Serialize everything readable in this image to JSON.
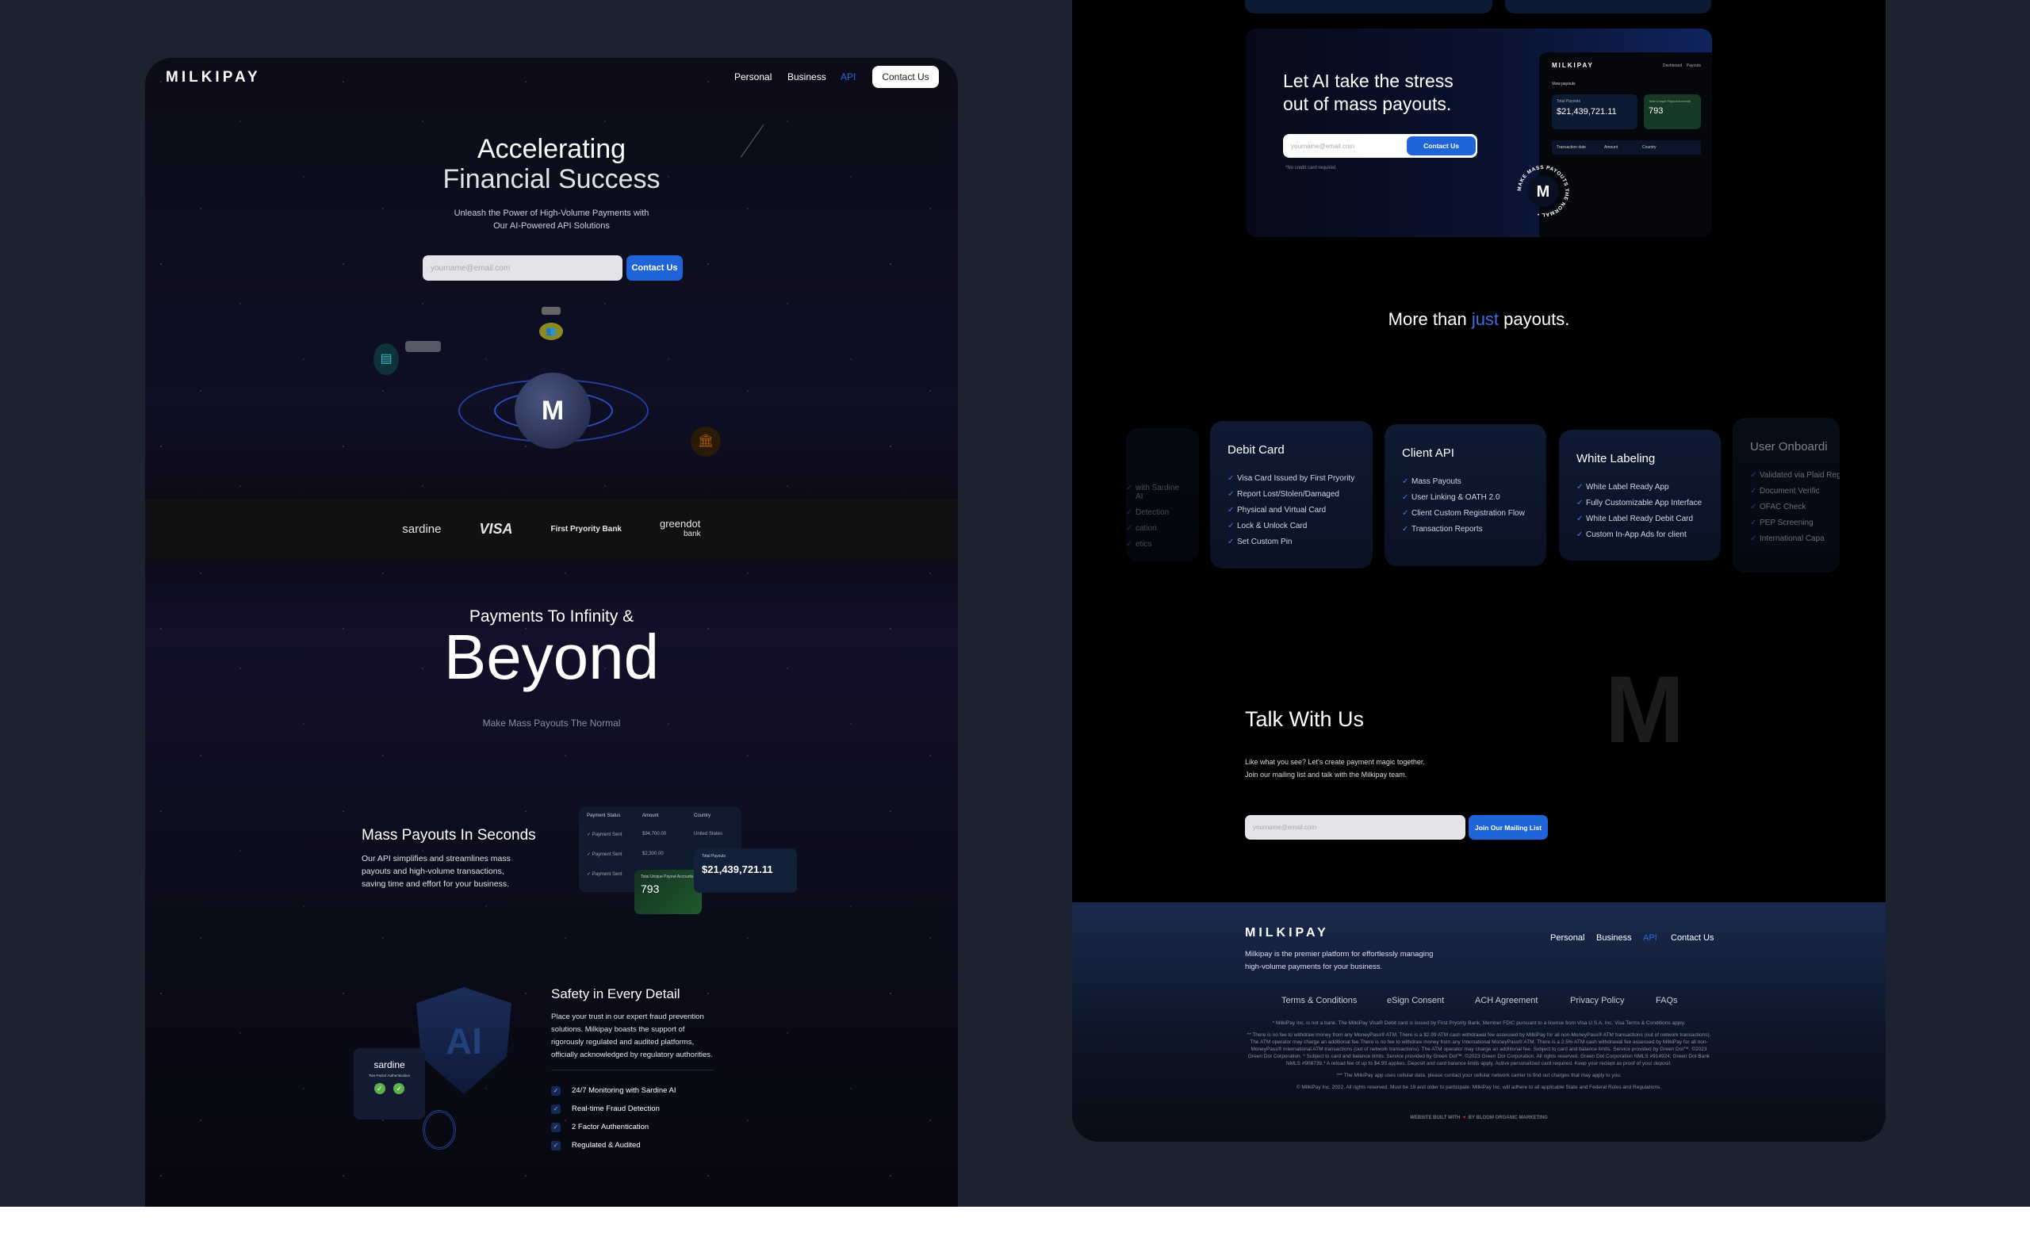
{
  "left": {
    "nav": {
      "logo": "MILKIPAY",
      "items": [
        "Personal",
        "Business",
        "API"
      ],
      "contact": "Contact Us",
      "accent": "#1f64d8"
    },
    "hero": {
      "title_line1": "Accelerating",
      "title_line2": "Financial Success",
      "subtitle_line1": "Unleash the Power of High-Volume Payments with",
      "subtitle_line2": "Our AI-Powered API Solutions",
      "email_placeholder": "yourname@email.com",
      "button": "Contact Us"
    },
    "partners": [
      "sardine",
      "VISA",
      "First Pryority Bank",
      "greendot",
      "bank"
    ],
    "beyond": {
      "kicker": "Payments To Infinity &",
      "title": "Beyond",
      "subtitle": "Make Mass Payouts The Normal"
    },
    "mass": {
      "title": "Mass Payouts In Seconds",
      "text": "Our API simplifies and streamlines mass payouts and high-volume transactions, saving time and effort for your business.",
      "table": {
        "headers": [
          "Payment Status",
          "Amount",
          "Country"
        ],
        "rows": [
          [
            "Payment Sent",
            "$94,700.00",
            "United States"
          ],
          [
            "Payment Sent",
            "$2,300.00",
            ""
          ],
          [
            "Payment Sent",
            "",
            ""
          ]
        ]
      },
      "total_label": "Total Payouts",
      "total_value": "$21,439,721.11",
      "accounts_label": "Total Unique Payout Accounts",
      "accounts_value": "793"
    },
    "safety": {
      "title": "Safety in Every Detail",
      "text": "Place your trust in our expert fraud prevention solutions. Milkipay boasts the support of rigorously regulated and audited platforms, officially acknowledged by regulatory authorities.",
      "items": [
        "24/7 Monitoring with Sardine AI",
        "Real-time Fraud Detection",
        "2 Factor Authentication",
        "Regulated & Audited"
      ],
      "badge_brand": "sardine",
      "badge_caption": "Two-Factor Authentication",
      "shield_text": "AI"
    }
  },
  "right": {
    "ai": {
      "title_line1": "Let AI take the stress",
      "title_line2": "out of mass payouts.",
      "email_placeholder": "yourname@email.com",
      "button": "Contact Us",
      "note": "*No credit card required",
      "dash": {
        "logo": "MILKIPAY",
        "nav": [
          "Dashboard",
          "Payouts"
        ],
        "heading": "View payouts",
        "total_label": "Total Payouts",
        "total": "$21,439,721.11",
        "accounts_label": "Total Unique Payout Accounts",
        "accounts": "793",
        "headers": [
          "Transaction date",
          "Amount",
          "Country"
        ]
      },
      "stamp": "MAKE MASS PAYOUTS THE NORMAL •"
    },
    "more": {
      "pre": "More than ",
      "accent": "just",
      "post": " payouts."
    },
    "cards": [
      {
        "title": "",
        "items": [
          "with Sardine AI",
          "Detection",
          "cation",
          "etics"
        ]
      },
      {
        "title": "Debit Card",
        "items": [
          "Visa Card Issued by First Pryority",
          "Report Lost/Stolen/Damaged",
          "Physical and Virtual Card",
          "Lock & Unlock Card",
          "Set Custom Pin"
        ]
      },
      {
        "title": "Client API",
        "items": [
          "Mass Payouts",
          "User Linking & OATH 2.0",
          "Client Custom Registration Flow",
          "Transaction Reports"
        ]
      },
      {
        "title": "White Labeling",
        "items": [
          "White Label Ready App",
          "Fully Customizable App Interface",
          "White Label Ready Debit Card",
          "Custom In-App Ads for client"
        ]
      },
      {
        "title": "User Onboardi",
        "items": [
          "Validated via Plaid Registration",
          "Document Verific",
          "OFAC Check",
          "PEP Screening",
          "International Capa"
        ]
      }
    ],
    "talk": {
      "title": "Talk With Us",
      "line1": "Like what you see? Let's create payment magic together.",
      "line2": "Join our mailing list and talk with the Milkipay team.",
      "email_placeholder": "yourname@email.com",
      "button": "Join Our Mailing List"
    },
    "footer": {
      "logo": "MILKIPAY",
      "tagline_line1": "Milkipay is the premier platform for effortlessly managing",
      "tagline_line2": "high-volume payments for your business.",
      "nav": [
        "Personal",
        "Business",
        "API",
        "Contact Us"
      ],
      "links": [
        "Terms & Conditions",
        "eSign Consent",
        "ACH Agreement",
        "Privacy Policy",
        "FAQs"
      ],
      "disclaimers": [
        "* MilkiPay Inc. is not a bank. The MilkiPay Visa® Debit card is issued by First Pryority Bank, Member FDIC pursuant to a license from Visa U.S.A. Inc. Visa Terms & Conditions apply.",
        "** There is no fee to withdraw money from any MoneyPass® ATM. There is a $2.99 ATM cash withdrawal fee assessed by MilkiPay for all non-MoneyPass® ATM transactions (out of network transactions). The ATM operator may charge an additional fee.There is no fee to withdraw money from any International MoneyPass® ATM. There is a 2.5% ATM cash withdrawal fee assessed by MilkiPay for all non-MoneyPass® International ATM transactions (out of network transactions). The ATM operator may charge an additional fee. Subject to card and balance limits. Service provided by Green Dot™. ©2023 Green Dot Corporation. * Subject to card and balance limits. Service provided by Green Dot™. ©2023 Green Dot Corporation. All rights reserved. Green Dot Corporation NMLS #914924; Green Dot Bank NMLS #908739.* A reload fee of up to $4.95 applies. Deposit and card balance limits apply. Active personalized card required. Keep your reciept as proof of your deposit.",
        "*** The MilkiPay app uses cellular data, please contact your cellular network carrier to find out charges that may apply to you.",
        "© MilkiPay Inc. 2022. All rights reserved. Must be 18 and older to participate. MilkiPay Inc. will adhere to all applicable State and Federal Rules and Regulations."
      ],
      "built_pre": "WEBSITE BUILT WITH",
      "built_post": "BY BLOOM ORGANIC MARKETING"
    }
  }
}
